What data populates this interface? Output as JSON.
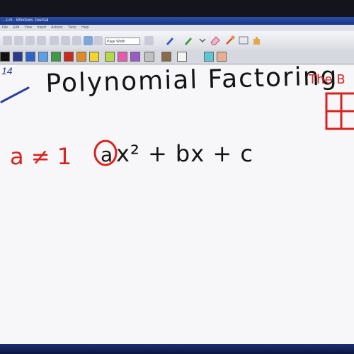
{
  "window": {
    "title": "…Lnt - Windows Journal",
    "menu": [
      "File",
      "Edit",
      "View",
      "Insert",
      "Actions",
      "Tools",
      "Help"
    ]
  },
  "toolbar": {
    "zoom_value": "Page Width"
  },
  "palette": {
    "colors": [
      "#111111",
      "#2a3a8a",
      "#2e64c8",
      "#5aa0e8",
      "#3f9a46",
      "#c82a1e",
      "#e08a22",
      "#f0d52a",
      "#b4d84a",
      "#e85ab0",
      "#9a5ac8",
      "#c0c0c0",
      "#8a6a4a",
      "#f4f4f4",
      "#58c8d8",
      "#e8b090"
    ]
  },
  "note": {
    "date_fragment": "14",
    "title": "Polynomial Factoring",
    "header_right": "The B",
    "condition": "a ≠ 1",
    "expression_circle": "a",
    "expression_rest": "x² + bx + c"
  },
  "colors": {
    "accent_ink": "#d8231f",
    "dark_ink": "#141414"
  }
}
